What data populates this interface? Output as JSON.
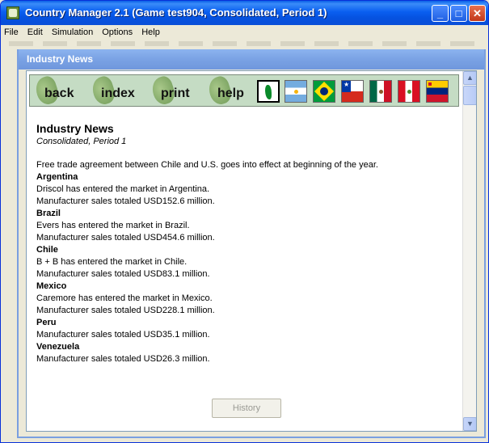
{
  "window": {
    "title": "Country Manager 2.1 (Game test904, Consolidated, Period 1)"
  },
  "menu": {
    "file": "File",
    "edit": "Edit",
    "simulation": "Simulation",
    "options": "Options",
    "help": "Help"
  },
  "child_window": {
    "title": "Industry News"
  },
  "navbar": {
    "back": "back",
    "index": "index",
    "print": "print",
    "help": "help"
  },
  "flags": [
    "map-icon",
    "argentina-flag-icon",
    "brazil-flag-icon",
    "chile-flag-icon",
    "mexico-flag-icon",
    "peru-flag-icon",
    "venezuela-flag-icon"
  ],
  "article": {
    "title": "Industry News",
    "subtitle": "Consolidated, Period 1",
    "intro": "Free trade agreement between Chile and U.S. goes into effect at beginning of the year.",
    "sections": [
      {
        "country": "Argentina",
        "lines": [
          "Driscol has entered the market in Argentina.",
          "Manufacturer sales totaled USD152.6 million."
        ]
      },
      {
        "country": "Brazil",
        "lines": [
          "Evers has entered the market in Brazil.",
          "Manufacturer sales totaled USD454.6 million."
        ]
      },
      {
        "country": "Chile",
        "lines": [
          "B + B has entered the market in Chile.",
          "Manufacturer sales totaled USD83.1 million."
        ]
      },
      {
        "country": "Mexico",
        "lines": [
          "Caremore has entered the market in Mexico.",
          "Manufacturer sales totaled USD228.1 million."
        ]
      },
      {
        "country": "Peru",
        "lines": [
          "Manufacturer sales totaled USD35.1 million."
        ]
      },
      {
        "country": "Venezuela",
        "lines": [
          "Manufacturer sales totaled USD26.3 million."
        ]
      }
    ]
  },
  "history_button": "History"
}
